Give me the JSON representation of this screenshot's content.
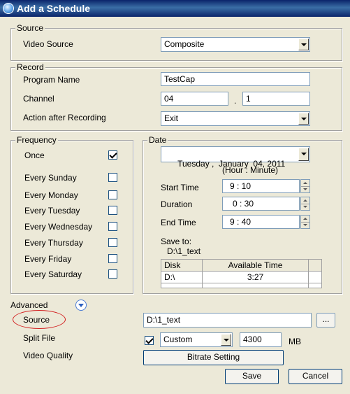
{
  "window": {
    "title": "Add a Schedule"
  },
  "source_group": {
    "label": "Source",
    "video_source_label": "Video Source",
    "video_source_value": "Composite"
  },
  "record_group": {
    "label": "Record",
    "program_name_label": "Program Name",
    "program_name_value": "TestCap",
    "channel_label": "Channel",
    "channel_major": "04",
    "channel_separator": ".",
    "channel_minor": "1",
    "action_label": "Action after Recording",
    "action_value": "Exit"
  },
  "frequency_group": {
    "label": "Frequency",
    "items": [
      {
        "label": "Once",
        "checked": true
      },
      {
        "label": "Every Sunday",
        "checked": false
      },
      {
        "label": "Every Monday",
        "checked": false
      },
      {
        "label": "Every Tuesday",
        "checked": false
      },
      {
        "label": "Every Wednesday",
        "checked": false
      },
      {
        "label": "Every Thursday",
        "checked": false
      },
      {
        "label": "Every Friday",
        "checked": false
      },
      {
        "label": "Every Saturday",
        "checked": false
      }
    ]
  },
  "date_group": {
    "label": "Date",
    "date_value": "Tuesday ,  January  04, 2011",
    "time_format_hint": "(Hour : Minute)",
    "start_time_label": "Start Time",
    "start_time_value": "9 : 10",
    "duration_label": "Duration",
    "duration_value": "0 : 30",
    "end_time_label": "End Time",
    "end_time_value": "9 : 40",
    "save_to_label": "Save to:",
    "save_to_path": "D:\\1_text",
    "disk_table": {
      "columns": [
        "Disk",
        "Available Time"
      ],
      "rows": [
        [
          "D:\\",
          "3:27"
        ]
      ]
    }
  },
  "advanced": {
    "label": "Advanced",
    "source_label": "Source",
    "source_path": "D:\\1_text",
    "browse_label": "...",
    "split_file_label": "Split File",
    "split_file_checked": true,
    "split_mode_value": "Custom",
    "split_size_value": "4300",
    "split_size_unit": "MB",
    "video_quality_label": "Video Quality",
    "bitrate_button_label": "Bitrate Setting",
    "annotation_color": "#d32020"
  },
  "buttons": {
    "save": "Save",
    "cancel": "Cancel"
  }
}
